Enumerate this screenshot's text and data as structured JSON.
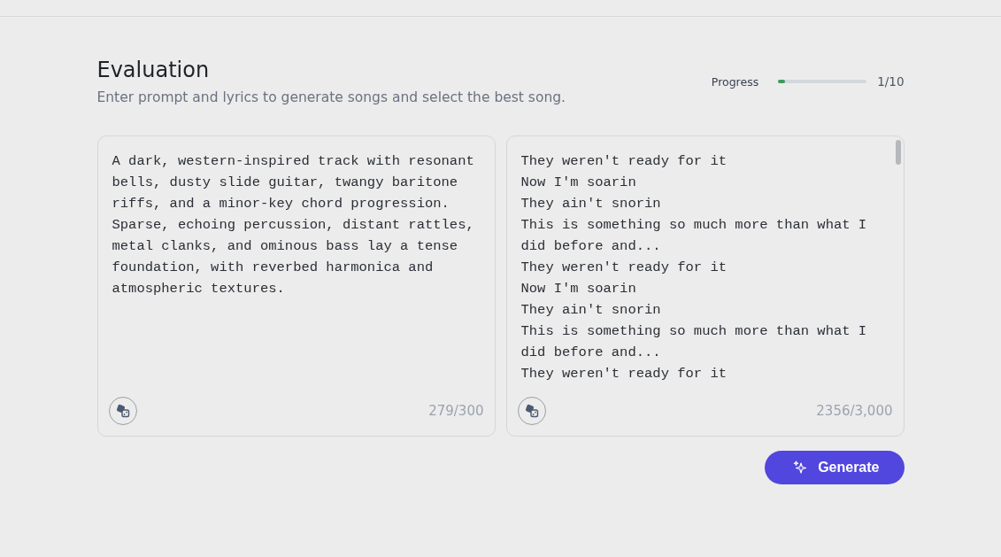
{
  "title": "Evaluation",
  "subtitle": "Enter prompt and lyrics to generate songs and select the best song.",
  "progress": {
    "label": "Progress",
    "level": 0.08,
    "reading": "1/10"
  },
  "fields": [
    {
      "kind": "prompt",
      "value": "A dark, western-inspired track with resonant bells, dusty slide guitar, twangy baritone riffs, and a minor-key chord progression. Sparse, echoing percussion, distant rattles, metal clanks, and ominous bass lay a tense foundation, with reverbed harmonica and atmospheric textures.",
      "counter": "279/300"
    },
    {
      "kind": "lyrics",
      "value": "They weren't ready for it\nNow I'm soarin\nThey ain't snorin\nThis is something so much more than what I did before and...\nThey weren't ready for it\nNow I'm soarin\nThey ain't snorin\nThis is something so much more than what I did before and...\nThey weren't ready for it",
      "counter": "2356/3,000"
    }
  ],
  "generate_button": "Generate"
}
